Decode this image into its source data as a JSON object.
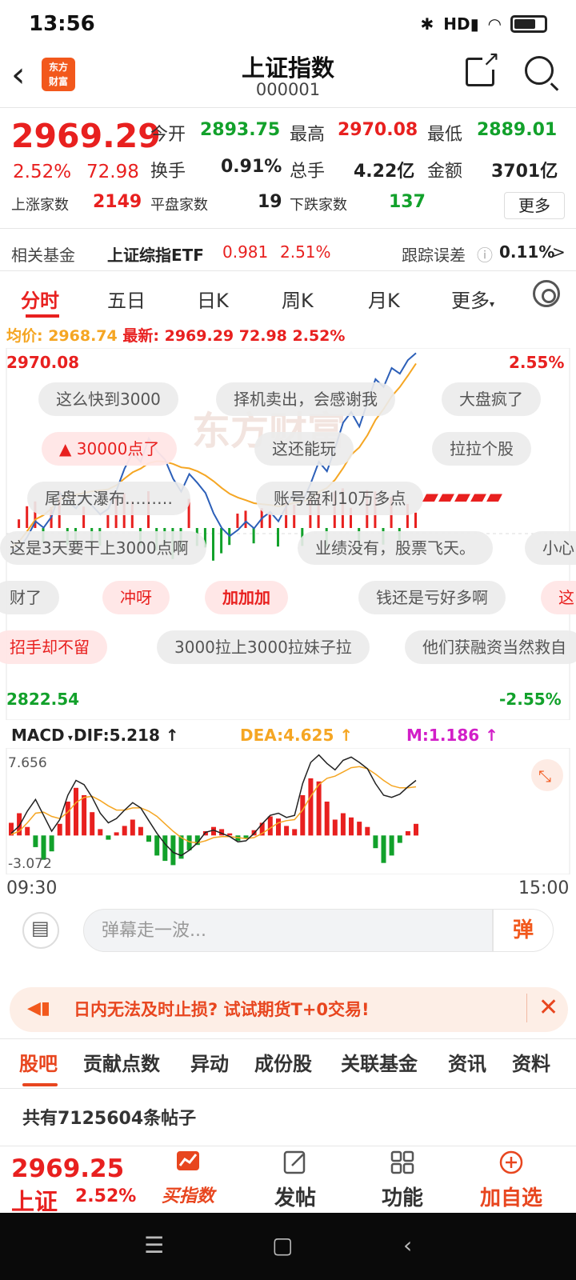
{
  "status": {
    "time": "13:56",
    "network": "HD",
    "icons": [
      "bluetooth-icon",
      "signal-icon",
      "wifi-icon",
      "battery-icon"
    ]
  },
  "header": {
    "title": "上证指数",
    "code": "000001",
    "logo_line1": "东方",
    "logo_line2": "财富"
  },
  "quote": {
    "price": "2969.29",
    "change_pct": "2.52%",
    "change": "72.98",
    "open_label": "今开",
    "open": "2893.75",
    "high_label": "最高",
    "high": "2970.08",
    "low_label": "最低",
    "low": "2889.01",
    "turnover_label": "换手",
    "turnover": "0.91%",
    "volume_label": "总手",
    "volume": "4.22亿",
    "amount_label": "金额",
    "amount": "3701亿",
    "up_label": "上涨家数",
    "up": "2149",
    "flat_label": "平盘家数",
    "flat": "19",
    "down_label": "下跌家数",
    "down": "137",
    "more": "更多"
  },
  "fund": {
    "label": "相关基金",
    "name": "上证综指ETF",
    "price": "0.981",
    "pct": "2.51%",
    "error_label": "跟踪误差",
    "error_value": "0.11%",
    "arrow": ">"
  },
  "tabs": [
    "分时",
    "五日",
    "日K",
    "周K",
    "月K",
    "更多"
  ],
  "avg_line": {
    "avg": "均价: 2968.74",
    "latest": "最新: 2969.29",
    "chg": "72.98",
    "pct": "2.52%"
  },
  "chart_labels": {
    "top_left": "2970.08",
    "top_right": "2.55%",
    "bottom_left": "2822.54",
    "bottom_right": "-2.55%",
    "watermark": "东方财富"
  },
  "danmu": [
    "这么快到3000",
    "择机卖出，会感谢我",
    "大盘疯了",
    "30000点了",
    "这还能玩",
    "拉拉个股",
    "尾盘大瀑布………",
    "账号盈利10万多点",
    "这是3天要干上3000点啊",
    "业绩没有，股票飞天。",
    "小心",
    "财了",
    "冲呀",
    "加加加",
    "钱还是亏好多啊",
    "这",
    "招手却不留",
    "3000拉上3000拉妹子拉",
    "他们获融资当然救自"
  ],
  "macd": {
    "name": "MACD",
    "dif": "DIF:5.218",
    "dea": "DEA:4.625",
    "m": "M:1.186",
    "max": "7.656",
    "min": "-3.072",
    "arrow": "↑"
  },
  "time_axis": {
    "start": "09:30",
    "end": "15:00"
  },
  "comment": {
    "placeholder": "弹幕走一波...",
    "danmu_btn": "弹"
  },
  "ad": {
    "text": "日内无法及时止损? 试试期货T+0交易!",
    "close": "✕"
  },
  "sub_tabs": [
    "股吧",
    "贡献点数",
    "异动",
    "成份股",
    "关联基金",
    "资讯",
    "资料"
  ],
  "posts": "共有7125604条帖子",
  "bottom": {
    "price": "2969.25",
    "name": "上证",
    "pct": "2.52%",
    "items": [
      "买指数",
      "发帖",
      "功能",
      "加自选"
    ]
  },
  "colors": {
    "up": "#e8201f",
    "down": "#12a12b",
    "accent": "#f2581c",
    "avg": "#f5a623",
    "price_line": "#2c5fb8"
  },
  "chart_data": {
    "type": "line",
    "x_range": [
      "09:30",
      "15:00"
    ],
    "ylim": [
      2822.54,
      2970.08
    ],
    "price_series": {
      "name": "最新",
      "values": [
        2889.5,
        2890.2,
        2895.0,
        2901.3,
        2898.7,
        2903.2,
        2912.8,
        2909.4,
        2906.5,
        2911.2,
        2907.6,
        2904.1,
        2906.3,
        2913.8,
        2922.6,
        2928.9,
        2925.3,
        2934.8,
        2929.7,
        2926.2,
        2918.5,
        2913.3,
        2920.4,
        2916.8,
        2912.7,
        2904.5,
        2898.6,
        2895.3,
        2897.8,
        2901.2,
        2898.4,
        2902.6,
        2905.1,
        2901.3,
        2907.5,
        2912.8,
        2909.2,
        2916.6,
        2925.4,
        2921.5,
        2930.8,
        2941.2,
        2945.5,
        2939.6,
        2949.4,
        2958.8,
        2955.6,
        2963.3,
        2961.0,
        2966.5,
        2969.3
      ]
    },
    "avg_series": {
      "name": "均价",
      "values": [
        2890.5,
        2893.2,
        2897.4,
        2902.1,
        2903.8,
        2906.5,
        2910.2,
        2911.5,
        2912.0,
        2912.8,
        2913.4,
        2913.8,
        2914.2,
        2915.9,
        2918.6,
        2921.1,
        2922.6,
        2924.8,
        2925.6,
        2925.4,
        2924.5,
        2923.1,
        2922.7,
        2921.5,
        2919.8,
        2917.5,
        2914.8,
        2912.4,
        2910.9,
        2909.8,
        2908.6,
        2908.2,
        2907.9,
        2907.3,
        2907.8,
        2908.8,
        2909.2,
        2910.6,
        2913.2,
        2914.8,
        2918.1,
        2922.8,
        2928.2,
        2931.2,
        2936.1,
        2942.3,
        2946.7,
        2951.8,
        2955.6,
        2960.2,
        2965.1
      ]
    }
  },
  "macd_data": {
    "type": "bar",
    "ylim": [
      -3.072,
      7.656
    ],
    "hist": [
      1.2,
      2.1,
      0.8,
      -1.1,
      -2.3,
      -1.5,
      1.1,
      3.2,
      4.5,
      3.8,
      2.2,
      0.6,
      -0.4,
      0.3,
      0.9,
      1.5,
      0.8,
      -0.6,
      -1.9,
      -2.4,
      -2.8,
      -2.2,
      -1.4,
      -0.9,
      0.4,
      0.8,
      0.6,
      0.2,
      -0.5,
      -0.3,
      0.5,
      1.2,
      1.8,
      1.6,
      0.9,
      0.6,
      3.8,
      5.4,
      5.1,
      3.2,
      1.5,
      2.1,
      1.7,
      1.3,
      0.8,
      -1.2,
      -2.6,
      -1.9,
      -0.7,
      0.4,
      1.1
    ],
    "dif": [
      0.2,
      0.9,
      2.3,
      3.4,
      1.9,
      0.4,
      1.5,
      3.8,
      5.2,
      4.8,
      3.6,
      2.1,
      1.2,
      1.6,
      2.4,
      3.1,
      2.6,
      1.4,
      0.2,
      -0.8,
      -1.6,
      -1.9,
      -1.4,
      -0.7,
      0.3,
      0.5,
      0.2,
      -0.1,
      -0.6,
      -0.5,
      0.2,
      1.1,
      1.9,
      2.1,
      1.7,
      1.9,
      4.9,
      6.9,
      7.6,
      6.8,
      6.2,
      7.1,
      7.4,
      6.9,
      6.3,
      4.9,
      3.8,
      3.6,
      3.9,
      4.6,
      5.2
    ],
    "dea": [
      0.1,
      0.4,
      1.2,
      2.1,
      2.2,
      1.8,
      1.6,
      2.2,
      3.1,
      3.6,
      3.7,
      3.3,
      2.8,
      2.4,
      2.4,
      2.6,
      2.6,
      2.3,
      1.8,
      1.1,
      0.4,
      -0.2,
      -0.6,
      -0.7,
      -0.5,
      -0.2,
      -0.1,
      -0.1,
      -0.2,
      -0.3,
      -0.2,
      0.2,
      0.7,
      1.2,
      1.4,
      1.5,
      2.4,
      3.7,
      4.8,
      5.4,
      5.6,
      6.0,
      6.4,
      6.5,
      6.3,
      5.8,
      5.2,
      4.7,
      4.5,
      4.5,
      4.6
    ]
  }
}
